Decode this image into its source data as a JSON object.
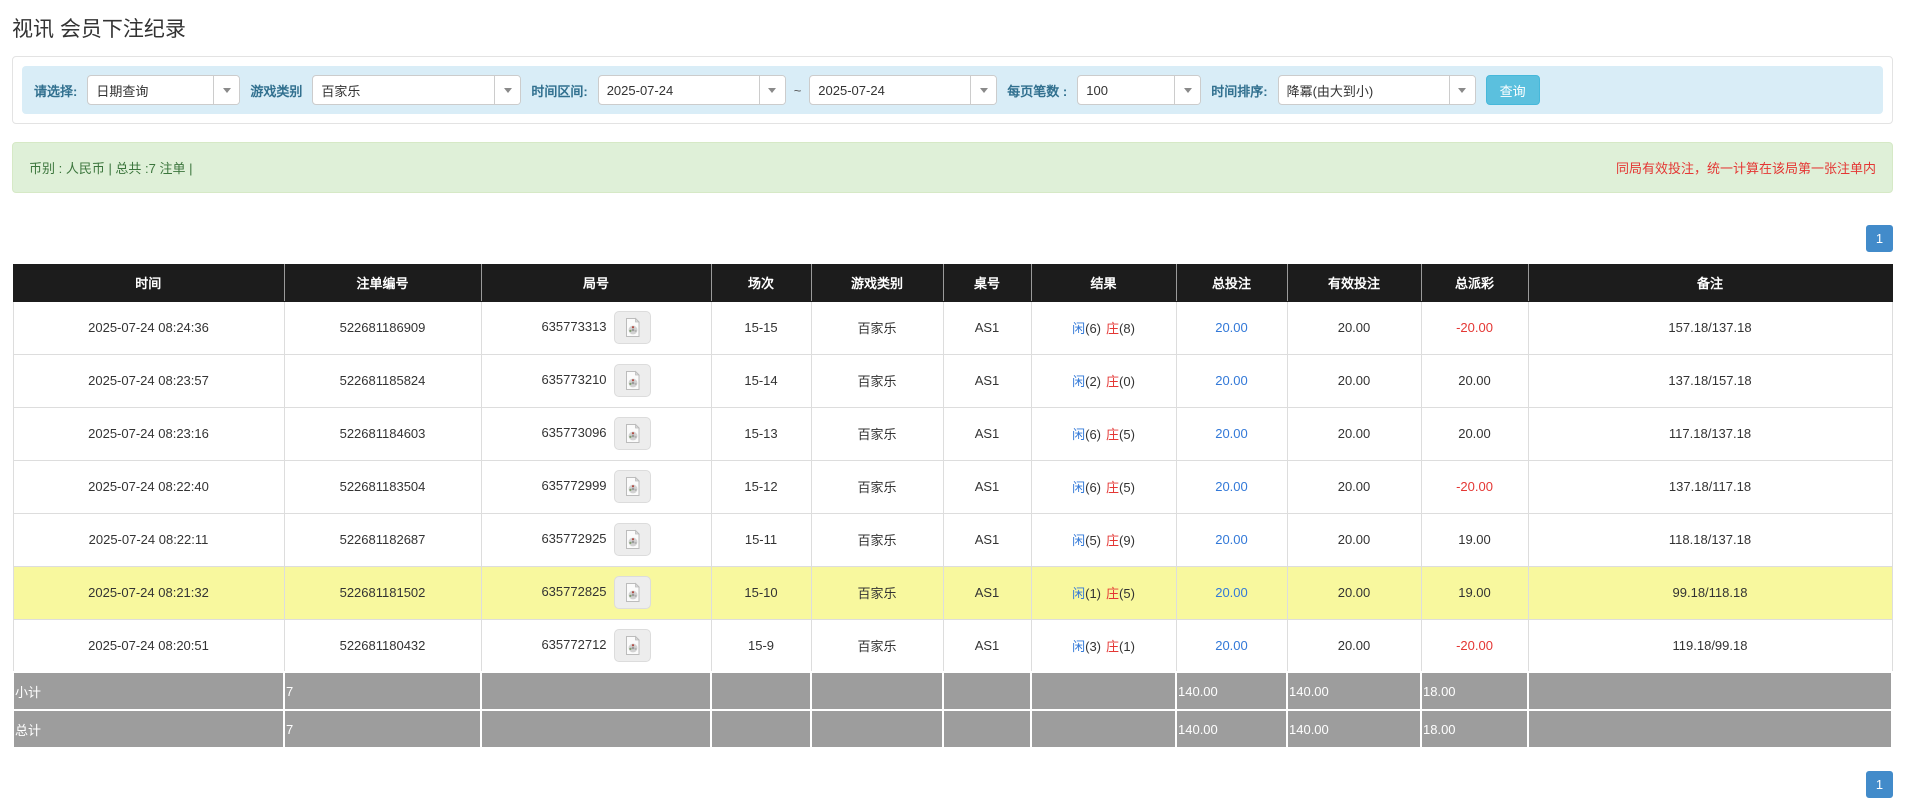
{
  "page": {
    "title": "视讯 会员下注纪录"
  },
  "filters": {
    "select_label": "请选择:",
    "select_value": "日期查询",
    "game_type_label": "游戏类别",
    "game_type_value": "百家乐",
    "date_range_label": "时间区间:",
    "date_from": "2025-07-24",
    "date_separator": "~",
    "date_to": "2025-07-24",
    "page_size_label": "每页笔数 :",
    "page_size_value": "100",
    "sort_label": "时间排序:",
    "sort_value": "降冪(由大到小)",
    "search_button_label": "查询"
  },
  "summary_bar": {
    "left_text": "币别 : 人民币 | 总共 :7 注单 |",
    "right_text": "同局有效投注，统一计算在该局第一张注单内"
  },
  "pagination": {
    "current_page": "1"
  },
  "table": {
    "headers": [
      "时间",
      "注单编号",
      "局号",
      "场次",
      "游戏类别",
      "桌号",
      "结果",
      "总投注",
      "有效投注",
      "总派彩",
      "备注"
    ],
    "rows": [
      {
        "time": "2025-07-24 08:24:36",
        "bet_id": "522681186909",
        "round_id": "635773313",
        "session": "15-15",
        "game": "百家乐",
        "table_no": "AS1",
        "player": "闲",
        "player_score": "(6)",
        "banker": "庄",
        "banker_score": "(8)",
        "total_bet": "20.00",
        "valid_bet": "20.00",
        "payout": "-20.00",
        "remark": "157.18/137.18",
        "highlight": false
      },
      {
        "time": "2025-07-24 08:23:57",
        "bet_id": "522681185824",
        "round_id": "635773210",
        "session": "15-14",
        "game": "百家乐",
        "table_no": "AS1",
        "player": "闲",
        "player_score": "(2)",
        "banker": "庄",
        "banker_score": "(0)",
        "total_bet": "20.00",
        "valid_bet": "20.00",
        "payout": "20.00",
        "remark": "137.18/157.18",
        "highlight": false
      },
      {
        "time": "2025-07-24 08:23:16",
        "bet_id": "522681184603",
        "round_id": "635773096",
        "session": "15-13",
        "game": "百家乐",
        "table_no": "AS1",
        "player": "闲",
        "player_score": "(6)",
        "banker": "庄",
        "banker_score": "(5)",
        "total_bet": "20.00",
        "valid_bet": "20.00",
        "payout": "20.00",
        "remark": "117.18/137.18",
        "highlight": false
      },
      {
        "time": "2025-07-24 08:22:40",
        "bet_id": "522681183504",
        "round_id": "635772999",
        "session": "15-12",
        "game": "百家乐",
        "table_no": "AS1",
        "player": "闲",
        "player_score": "(6)",
        "banker": "庄",
        "banker_score": "(5)",
        "total_bet": "20.00",
        "valid_bet": "20.00",
        "payout": "-20.00",
        "remark": "137.18/117.18",
        "highlight": false
      },
      {
        "time": "2025-07-24 08:22:11",
        "bet_id": "522681182687",
        "round_id": "635772925",
        "session": "15-11",
        "game": "百家乐",
        "table_no": "AS1",
        "player": "闲",
        "player_score": "(5)",
        "banker": "庄",
        "banker_score": "(9)",
        "total_bet": "20.00",
        "valid_bet": "20.00",
        "payout": "19.00",
        "remark": "118.18/137.18",
        "highlight": false
      },
      {
        "time": "2025-07-24 08:21:32",
        "bet_id": "522681181502",
        "round_id": "635772825",
        "session": "15-10",
        "game": "百家乐",
        "table_no": "AS1",
        "player": "闲",
        "player_score": "(1)",
        "banker": "庄",
        "banker_score": "(5)",
        "total_bet": "20.00",
        "valid_bet": "20.00",
        "payout": "19.00",
        "remark": "99.18/118.18",
        "highlight": true
      },
      {
        "time": "2025-07-24 08:20:51",
        "bet_id": "522681180432",
        "round_id": "635772712",
        "session": "15-9",
        "game": "百家乐",
        "table_no": "AS1",
        "player": "闲",
        "player_score": "(3)",
        "banker": "庄",
        "banker_score": "(1)",
        "total_bet": "20.00",
        "valid_bet": "20.00",
        "payout": "-20.00",
        "remark": "119.18/99.18",
        "highlight": false
      }
    ],
    "subtotal": {
      "label": "小计",
      "count": "7",
      "total_bet": "140.00",
      "valid_bet": "140.00",
      "payout": "18.00"
    },
    "grand_total": {
      "label": "总计",
      "count": "7",
      "total_bet": "140.00",
      "valid_bet": "140.00",
      "payout": "18.00"
    }
  },
  "colors": {
    "accent_blue": "#3379d8",
    "result_red": "#e43734",
    "highlight_yellow": "#f8f89e",
    "header_black": "#1c1c1c",
    "summary_grey": "#9d9d9d",
    "alert_bg_green": "#dff0d8",
    "alert_text_green": "#3c763d",
    "filter_bar_blue": "#d9edf7",
    "search_button_cyan": "#5bc0de",
    "pager_blue": "#428bca"
  }
}
